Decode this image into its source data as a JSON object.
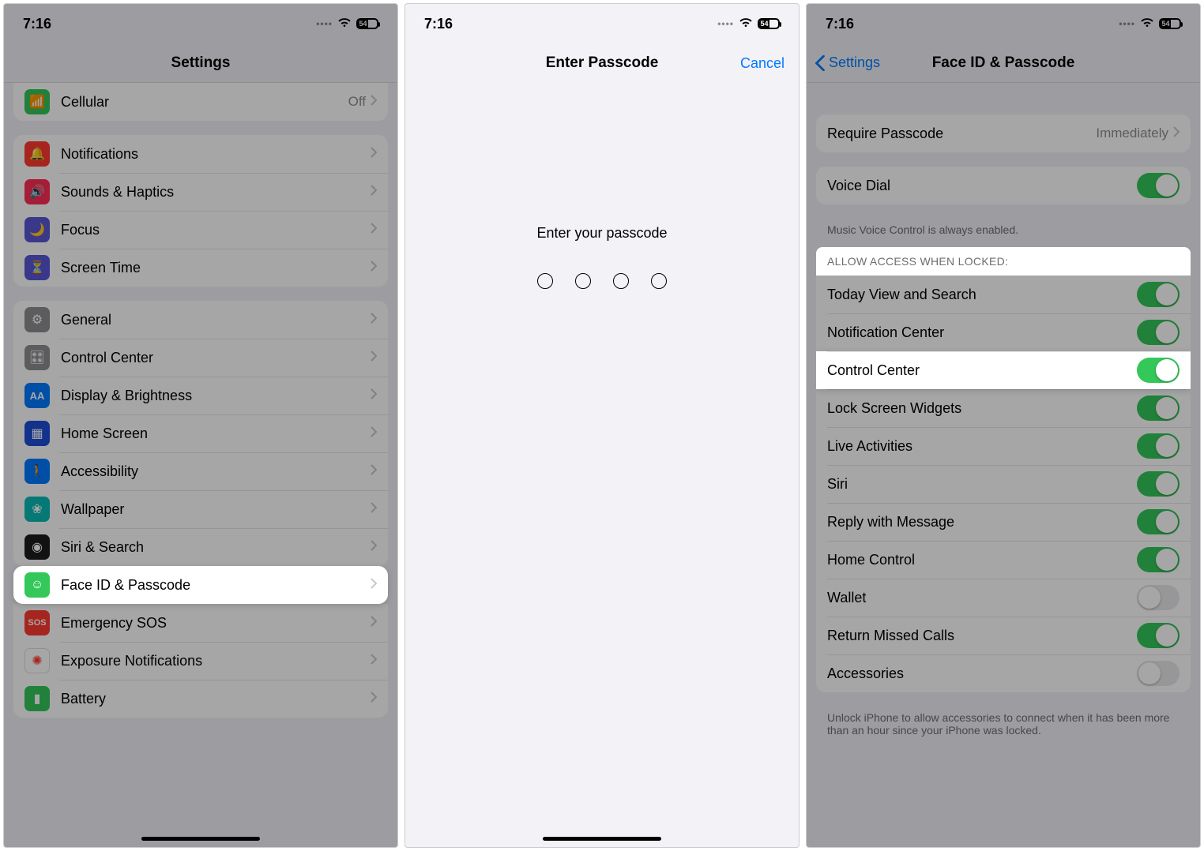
{
  "status": {
    "time": "7:16",
    "battery_text": "54",
    "battery_pct": 54
  },
  "panel1": {
    "title": "Settings",
    "cellular": {
      "label": "Cellular",
      "detail": "Off"
    },
    "group1": [
      {
        "label": "Notifications"
      },
      {
        "label": "Sounds & Haptics"
      },
      {
        "label": "Focus"
      },
      {
        "label": "Screen Time"
      }
    ],
    "group2": [
      {
        "label": "General"
      },
      {
        "label": "Control Center"
      },
      {
        "label": "Display & Brightness"
      },
      {
        "label": "Home Screen"
      },
      {
        "label": "Accessibility"
      },
      {
        "label": "Wallpaper"
      },
      {
        "label": "Siri & Search"
      },
      {
        "label": "Face ID & Passcode"
      },
      {
        "label": "Emergency SOS"
      },
      {
        "label": "Exposure Notifications"
      },
      {
        "label": "Battery"
      }
    ]
  },
  "panel2": {
    "title": "Enter Passcode",
    "cancel": "Cancel",
    "prompt": "Enter your passcode"
  },
  "panel3": {
    "back": "Settings",
    "title": "Face ID & Passcode",
    "require": {
      "label": "Require Passcode",
      "detail": "Immediately"
    },
    "voice_dial": {
      "label": "Voice Dial"
    },
    "voice_footer": "Music Voice Control is always enabled.",
    "allow_header": "ALLOW ACCESS WHEN LOCKED:",
    "allow": [
      {
        "label": "Today View and Search",
        "on": true
      },
      {
        "label": "Notification Center",
        "on": true
      },
      {
        "label": "Control Center",
        "on": true
      },
      {
        "label": "Lock Screen Widgets",
        "on": true
      },
      {
        "label": "Live Activities",
        "on": true
      },
      {
        "label": "Siri",
        "on": true
      },
      {
        "label": "Reply with Message",
        "on": true
      },
      {
        "label": "Home Control",
        "on": true
      },
      {
        "label": "Wallet",
        "on": false
      },
      {
        "label": "Return Missed Calls",
        "on": true
      },
      {
        "label": "Accessories",
        "on": false
      }
    ],
    "accessory_footer": "Unlock iPhone to allow accessories to connect when it has been more than an hour since your iPhone was locked."
  }
}
